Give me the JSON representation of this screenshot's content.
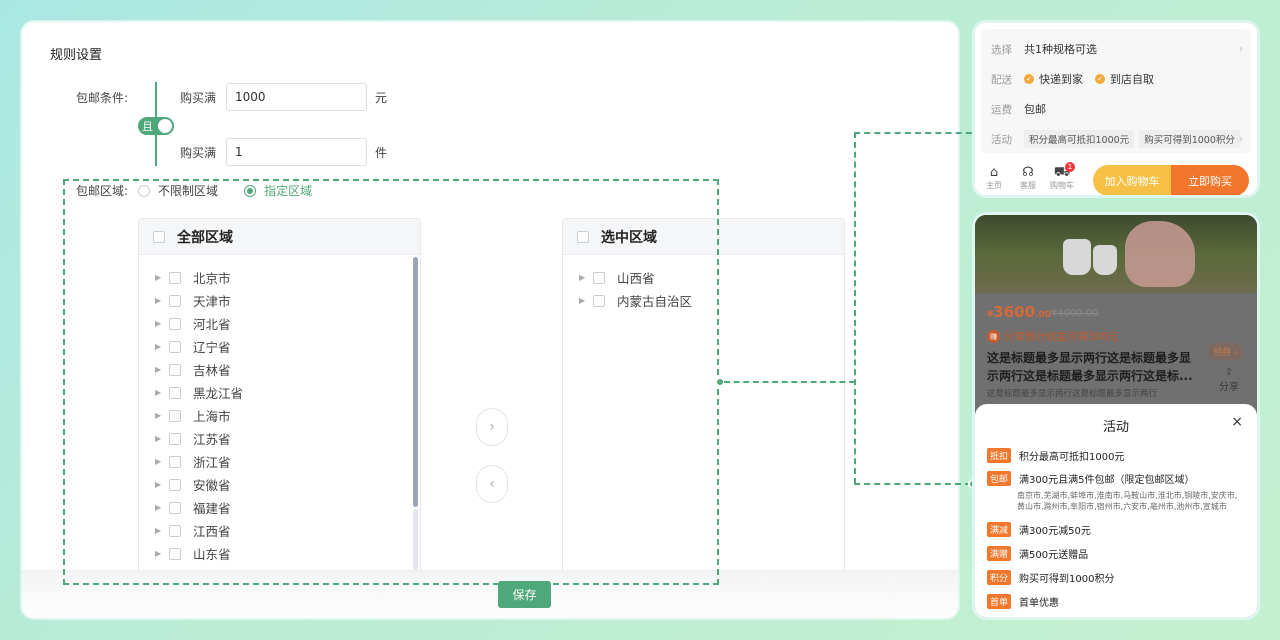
{
  "rule": {
    "section_title": "规则设置",
    "condition_label": "包邮条件:",
    "and_label": "且",
    "amount": {
      "label": "购买满",
      "value": "1000",
      "unit": "元"
    },
    "count": {
      "label": "购买满",
      "value": "1",
      "unit": "件"
    },
    "region_label": "包邮区域:",
    "region_options": [
      {
        "label": "不限制区域",
        "checked": false
      },
      {
        "label": "指定区域",
        "checked": true
      }
    ],
    "all_regions": {
      "title": "全部区域",
      "items": [
        "北京市",
        "天津市",
        "河北省",
        "辽宁省",
        "吉林省",
        "黑龙江省",
        "上海市",
        "江苏省",
        "浙江省",
        "安徽省",
        "福建省",
        "江西省",
        "山东省"
      ]
    },
    "selected_regions": {
      "title": "选中区域",
      "items": [
        "山西省",
        "内蒙古自治区"
      ]
    },
    "move_right_glyph": "›",
    "move_left_glyph": "‹",
    "save_label": "保存"
  },
  "product_bar": {
    "rows": {
      "spec": {
        "key": "选择",
        "value": "共1种规格可选"
      },
      "delivery": {
        "key": "配送",
        "opt1": "快递到家",
        "opt2": "到店自取"
      },
      "shipping": {
        "key": "运费",
        "value": "包邮"
      },
      "activity": {
        "key": "活动",
        "pill1": "积分最高可抵扣1000元",
        "pill2": "购买可得到1000积分"
      }
    },
    "footer": {
      "home": "主页",
      "service": "客服",
      "cart": "购物车",
      "cart_count": "1",
      "add_cart": "加入购物车",
      "buy_now": "立即购买"
    }
  },
  "product_detail": {
    "price_symbol": "¥",
    "price_int": "3600",
    "price_dec": ".00",
    "price_old": "¥4000.00",
    "share_earn": "分享预计收益可得300元",
    "share_earn_icon": "赚",
    "title": "这是标题最多显示两行这是标题最多显示两行这是标题最多显示两行这是标...",
    "subtitle": "这是标题最多显示两行这是标题最多显示两行",
    "coupon": "领券 ›",
    "share": "分享",
    "sheet": {
      "title": "活动",
      "close": "×",
      "items": [
        {
          "tag": "抵扣",
          "text": "积分最高可抵扣1000元"
        },
        {
          "tag": "包邮",
          "text": "满300元且满5件包邮（限定包邮区域）"
        },
        {
          "tag": "满减",
          "text": "满300元减50元"
        },
        {
          "tag": "满赠",
          "text": "满500元送赠品"
        },
        {
          "tag": "积分",
          "text": "购买可得到1000积分"
        },
        {
          "tag": "首单",
          "text": "首单优惠"
        }
      ],
      "free_ship_cities": "南京市,芜湖市,蚌埠市,淮南市,马鞍山市,淮北市,铜陵市,安庆市,黄山市,滁州市,阜阳市,宿州市,六安市,亳州市,池州市,宣城市"
    }
  },
  "colors": {
    "accent": "#4ea879",
    "orange": "#f2762b",
    "yellow": "#f5c043"
  }
}
